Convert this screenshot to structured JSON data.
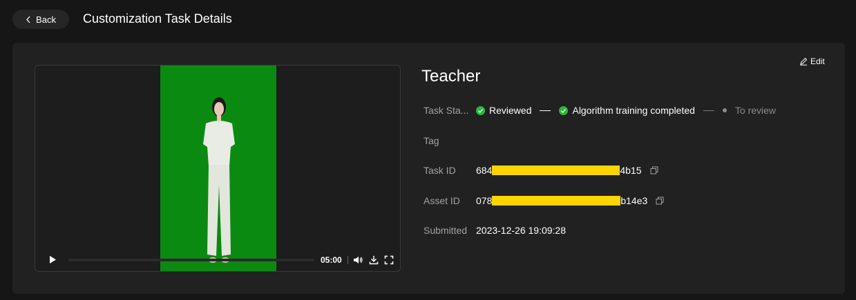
{
  "header": {
    "back_label": "Back",
    "title": "Customization Task Details"
  },
  "video": {
    "duration": "05:00",
    "progress_fraction": 0.0,
    "background_color": "#0b8a12"
  },
  "details": {
    "edit_label": "Edit",
    "title": "Teacher",
    "task_status": {
      "label": "Task Sta...",
      "steps": [
        {
          "label": "Reviewed",
          "state": "done"
        },
        {
          "label": "Algorithm training completed",
          "state": "done"
        },
        {
          "label": "To review",
          "state": "pending"
        }
      ]
    },
    "tag": {
      "label": "Tag",
      "value": ""
    },
    "task_id": {
      "label": "Task ID",
      "prefix": "684",
      "suffix": "4b15"
    },
    "asset_id": {
      "label": "Asset ID",
      "prefix": "078",
      "suffix": "b14e3"
    },
    "submitted": {
      "label": "Submitted",
      "value": "2023-12-26 19:09:28"
    }
  },
  "colors": {
    "success": "#2db83d",
    "redaction": "#ffd400"
  }
}
